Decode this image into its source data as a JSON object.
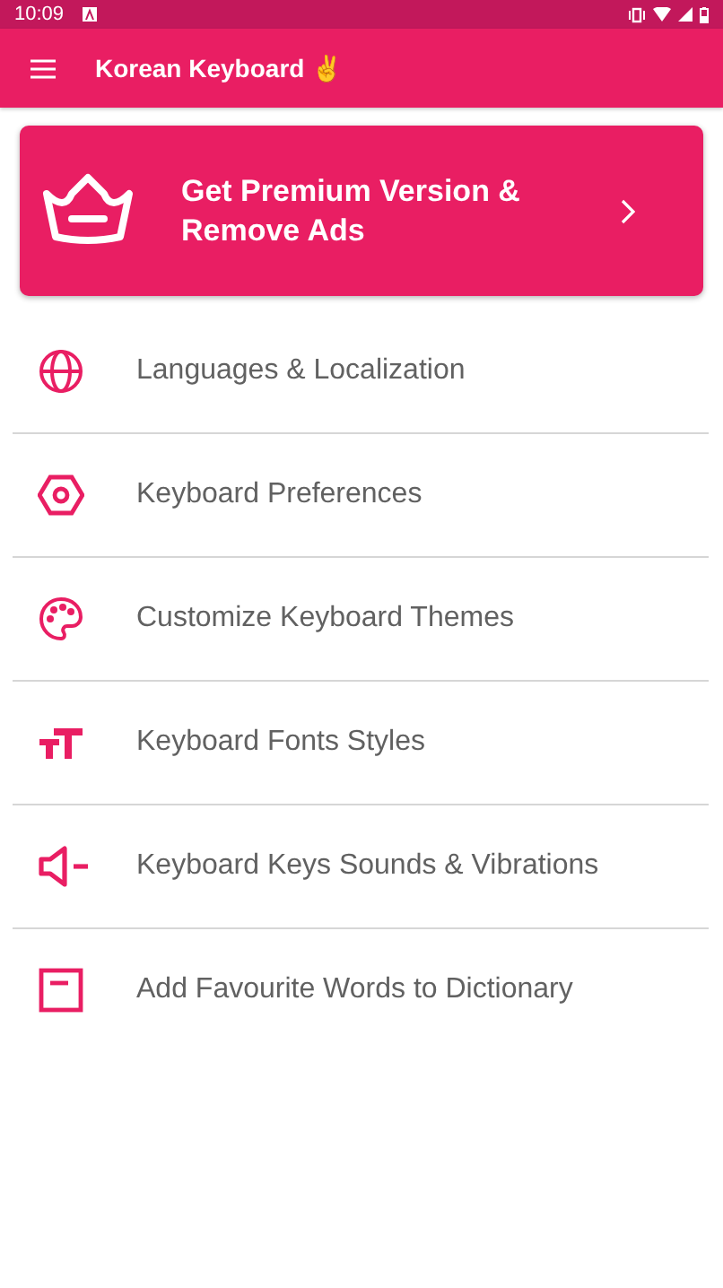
{
  "status_bar": {
    "time": "10:09"
  },
  "app_bar": {
    "title": "Korean Keyboard ✌"
  },
  "premium_card": {
    "text": "Get Premium Version & Remove Ads"
  },
  "menu_items": [
    {
      "kind": "globe",
      "label": "Languages & Localization"
    },
    {
      "kind": "hexagon",
      "label": "Keyboard Preferences"
    },
    {
      "kind": "palette",
      "label": "Customize Keyboard Themes"
    },
    {
      "kind": "font",
      "label": "Keyboard Fonts Styles"
    },
    {
      "kind": "speaker",
      "label": "Keyboard Keys Sounds & Vibrations"
    },
    {
      "kind": "note",
      "label": "Add Favourite Words to Dictionary"
    }
  ]
}
